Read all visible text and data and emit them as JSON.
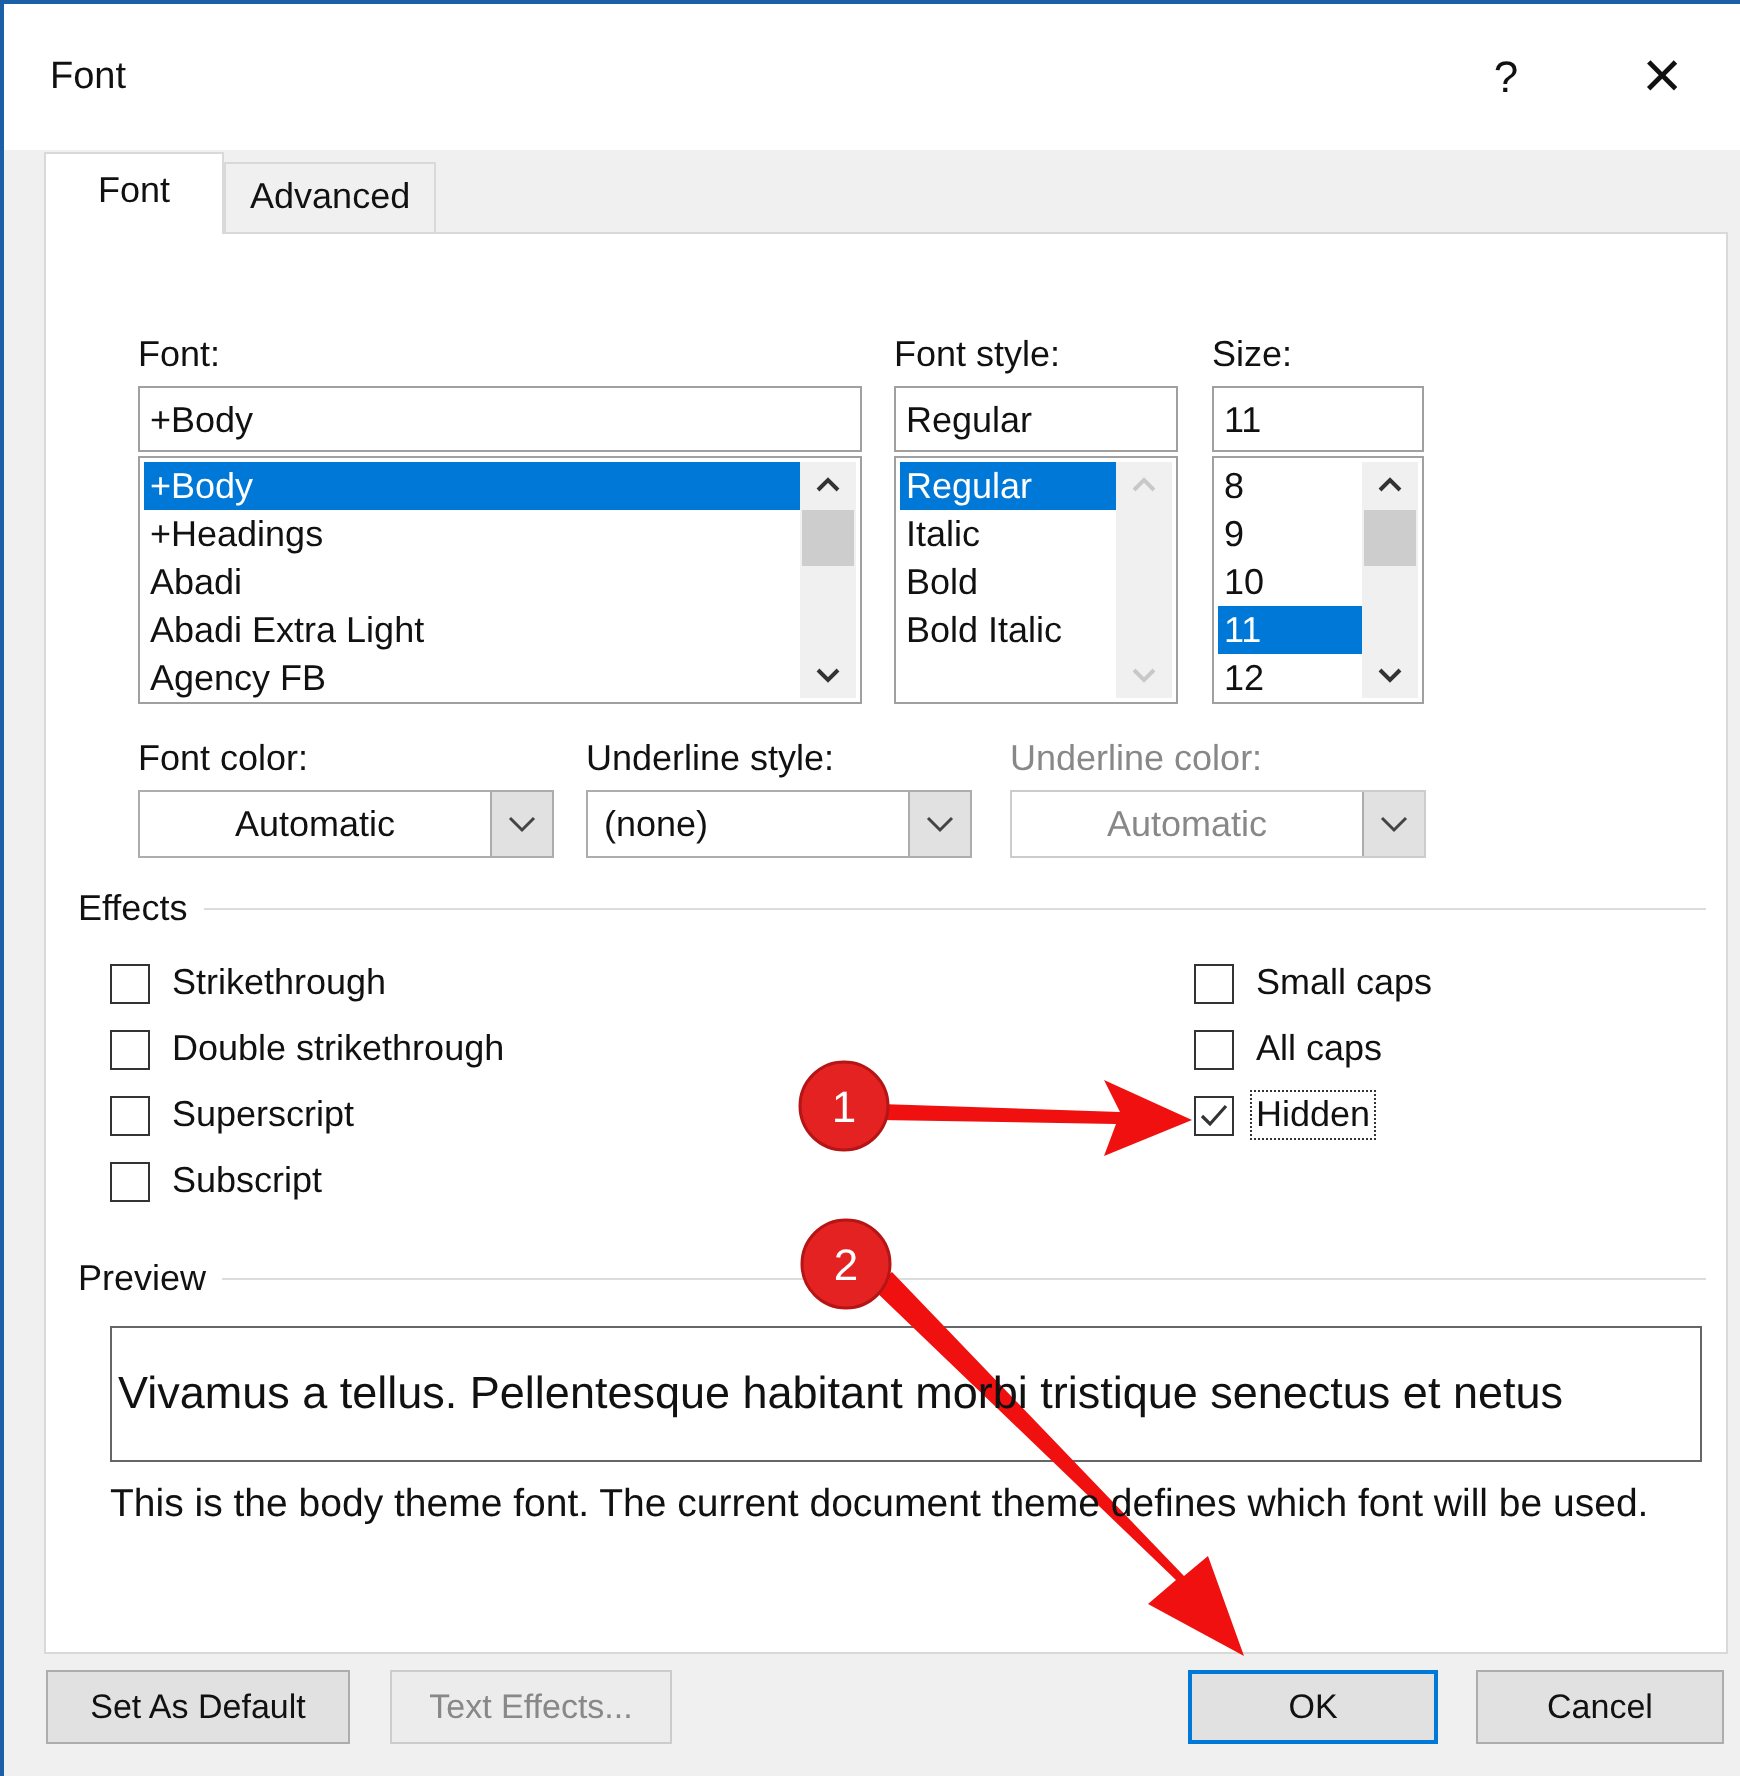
{
  "window": {
    "title": "Font",
    "help": "?",
    "close": "×"
  },
  "tabs": [
    {
      "label": "Font",
      "selected": true
    },
    {
      "label": "Advanced",
      "selected": false
    }
  ],
  "font": {
    "label": "Font:",
    "value": "+Body",
    "items": [
      {
        "label": "+Body",
        "selected": true
      },
      {
        "label": "+Headings",
        "selected": false
      },
      {
        "label": "Abadi",
        "selected": false
      },
      {
        "label": "Abadi Extra Light",
        "selected": false
      },
      {
        "label": "Agency FB",
        "selected": false
      }
    ]
  },
  "font_style": {
    "label": "Font style:",
    "value": "Regular",
    "items": [
      {
        "label": "Regular",
        "selected": true
      },
      {
        "label": "Italic",
        "selected": false
      },
      {
        "label": "Bold",
        "selected": false
      },
      {
        "label": "Bold Italic",
        "selected": false
      }
    ]
  },
  "size": {
    "label": "Size:",
    "value": "11",
    "items": [
      {
        "label": "8",
        "selected": false
      },
      {
        "label": "9",
        "selected": false
      },
      {
        "label": "10",
        "selected": false
      },
      {
        "label": "11",
        "selected": true
      },
      {
        "label": "12",
        "selected": false
      }
    ]
  },
  "dropdowns": [
    {
      "label": "Font color:",
      "value": "Automatic",
      "disabled": false,
      "centered": true
    },
    {
      "label": "Underline style:",
      "value": "(none)",
      "disabled": false,
      "centered": false
    },
    {
      "label": "Underline color:",
      "value": "Automatic",
      "disabled": true,
      "centered": true
    }
  ],
  "effects": {
    "title": "Effects",
    "left": [
      {
        "label": "Strikethrough",
        "checked": false,
        "focused": false
      },
      {
        "label": "Double strikethrough",
        "checked": false,
        "focused": false
      },
      {
        "label": "Superscript",
        "checked": false,
        "focused": false
      },
      {
        "label": "Subscript",
        "checked": false,
        "focused": false
      }
    ],
    "right": [
      {
        "label": "Small caps",
        "checked": false,
        "focused": false
      },
      {
        "label": "All caps",
        "checked": false,
        "focused": false
      },
      {
        "label": "Hidden",
        "checked": true,
        "focused": true
      }
    ]
  },
  "preview": {
    "title": "Preview",
    "sample": "Vivamus a tellus. Pellentesque habitant morbi tristique senectus et netus",
    "note": "This is the body theme font. The current document theme defines which font will be used."
  },
  "buttons": [
    {
      "label": "Set As Default",
      "disabled": false,
      "default": false
    },
    {
      "label": "Text Effects...",
      "disabled": true,
      "default": false
    },
    {
      "label": "OK",
      "disabled": false,
      "default": true
    },
    {
      "label": "Cancel",
      "disabled": false,
      "default": false
    }
  ],
  "annotations": [
    {
      "number": "1"
    },
    {
      "number": "2"
    }
  ]
}
